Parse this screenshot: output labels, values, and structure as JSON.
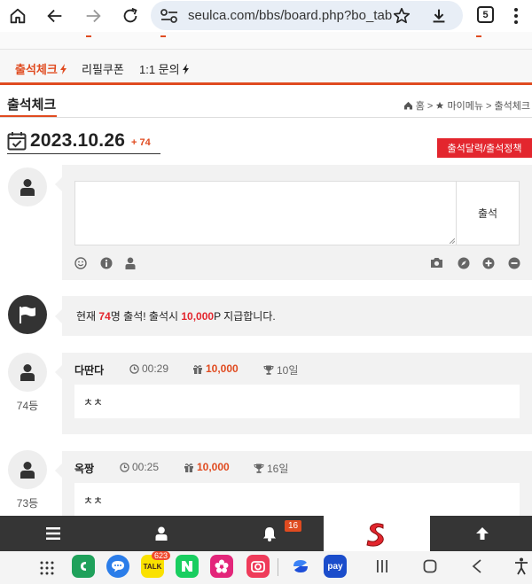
{
  "browser": {
    "url": "seulca.com/bbs/board.php?bo_tab",
    "tab_count": "5"
  },
  "quick_menu": {
    "items": [
      {
        "label": "출석체크",
        "active": true
      },
      {
        "label": "리필쿠폰",
        "active": false
      },
      {
        "label": "1:1 문의",
        "active": false
      }
    ]
  },
  "page": {
    "title": "출석체크",
    "breadcrumb": {
      "home": "홈",
      "sep1": ">",
      "my_menu": "마이메뉴",
      "sep2": ">",
      "current": "출석체크"
    },
    "date": "2023.10.26",
    "date_count": "+ 74",
    "policy_button": "출석달력/출석정책"
  },
  "composer": {
    "submit_label": "출석"
  },
  "notice": {
    "prefix": "현재 ",
    "count": "74",
    "mid": "명 출석! 출석시 ",
    "points": "10,000",
    "suffix": "P 지급합니다."
  },
  "entries": [
    {
      "rank": "74등",
      "name": "다딴다",
      "time": "00:29",
      "points": "10,000",
      "days": "10일",
      "message": "ㅊㅊ"
    },
    {
      "rank": "73등",
      "name": "옥짱",
      "time": "00:25",
      "points": "10,000",
      "days": "16일",
      "message": "ㅊㅊ"
    }
  ],
  "site_nav": {
    "notification_count": "16"
  },
  "android": {
    "talk_badge": "623",
    "talk_label": "TALK",
    "pay_label": "pay"
  },
  "colors": {
    "accent": "#e04b20",
    "policy_red": "#e3262e",
    "nav_dark": "#353535"
  }
}
